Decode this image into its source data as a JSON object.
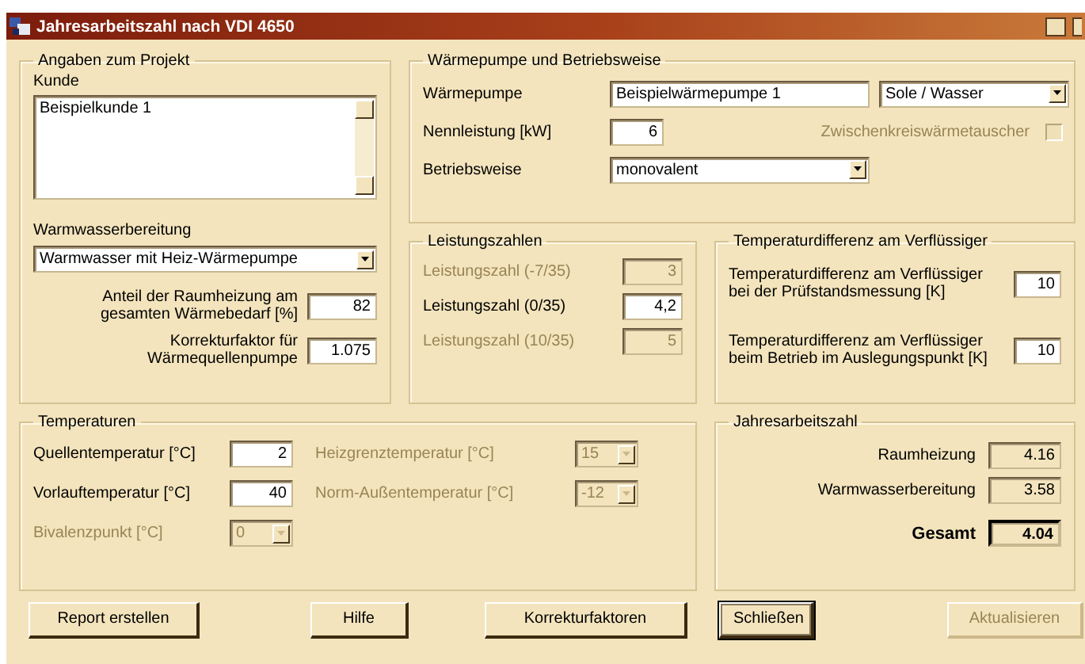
{
  "window": {
    "title": "Jahresarbeitszahl nach VDI 4650"
  },
  "project": {
    "title": "Angaben zum Projekt",
    "customer_label": "Kunde",
    "customer_value": "Beispielkunde 1",
    "hot_water_label": "Warmwasserbereitung",
    "hot_water_value": "Warmwasser mit Heiz-Wärmepumpe",
    "fields": [
      {
        "label": "Anteil der Raumheizung am gesamten Wärmebedarf [%]",
        "value": "82"
      },
      {
        "label": "Korrekturfaktor für Wärmequellenpumpe",
        "value": "1.075"
      }
    ]
  },
  "heat_pump": {
    "title": "Wärmepumpe und Betriebsweise",
    "pump_label": "Wärmepumpe",
    "pump_value": "Beispielwärmepumpe 1",
    "type_value": "Sole / Wasser",
    "rating_label": "Nennleistung [kW]",
    "rating_value": "6",
    "exchanger": {
      "label": "Zwischenkreiswärmetauscher",
      "checked": false,
      "disabled": true
    },
    "mode_label": "Betriebsweise",
    "mode_value": "monovalent"
  },
  "cop": {
    "title": "Leistungszahlen",
    "rows": [
      {
        "label": "Leistungszahl (-7/35)",
        "value": "3",
        "disabled": true
      },
      {
        "label": "Leistungszahl (0/35)",
        "value": "4,2",
        "disabled": false
      },
      {
        "label": "Leistungszahl (10/35)",
        "value": "5",
        "disabled": true
      }
    ]
  },
  "condenser": {
    "title": "Temperaturdifferenz am Verflüssiger",
    "rows": [
      {
        "label": "Temperaturdifferenz am Verflüssiger bei der Prüfstandsmessung [K]",
        "value": "10"
      },
      {
        "label": "Temperaturdifferenz am Verflüssiger beim Betrieb im Auslegungspunkt [K]",
        "value": "10"
      }
    ]
  },
  "temperatures": {
    "title": "Temperaturen",
    "fields": [
      {
        "label": "Quellentemperatur [°C]",
        "value": "2",
        "kind": "text",
        "disabled": false
      },
      {
        "label": "Heizgrenztemperatur [°C]",
        "value": "15",
        "kind": "combo",
        "disabled": true
      },
      {
        "label": "Vorlauftemperatur [°C]",
        "value": "40",
        "kind": "text",
        "disabled": false
      },
      {
        "label": "Norm-Außentemperatur [°C]",
        "value": "-12",
        "kind": "combo",
        "disabled": true
      },
      {
        "label": "Bivalenzpunkt [°C]",
        "value": "0",
        "kind": "combo",
        "disabled": true
      }
    ]
  },
  "annual": {
    "title": "Jahresarbeitszahl",
    "rows": [
      {
        "label": "Raumheizung",
        "value": "4.16",
        "emphasis": false
      },
      {
        "label": "Warmwasserbereitung",
        "value": "3.58",
        "emphasis": false
      },
      {
        "label": "Gesamt",
        "value": "4.04",
        "emphasis": true
      }
    ]
  },
  "buttons": [
    {
      "label": "Report erstellen",
      "disabled": false,
      "default": false
    },
    {
      "label": "Hilfe",
      "disabled": false,
      "default": false
    },
    {
      "label": "Korrekturfaktoren",
      "disabled": false,
      "default": false
    },
    {
      "label": "Schließen",
      "disabled": false,
      "default": true
    },
    {
      "label": "Aktualisieren",
      "disabled": true,
      "default": false
    }
  ]
}
